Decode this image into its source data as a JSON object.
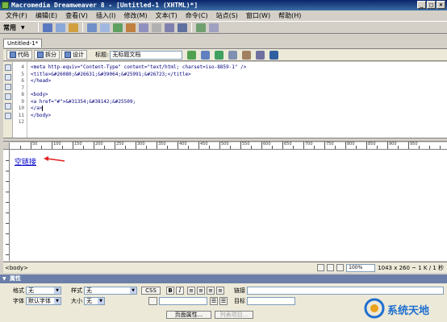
{
  "window": {
    "title": "Macromedia Dreamweaver 8 - [Untitled-1 (XHTML)*]",
    "controls": [
      "_",
      "□",
      "×"
    ]
  },
  "menu": [
    "文件(F)",
    "编辑(E)",
    "查看(V)",
    "插入(I)",
    "修改(M)",
    "文本(T)",
    "命令(C)",
    "站点(S)",
    "窗口(W)",
    "帮助(H)"
  ],
  "insert_bar": {
    "category": "常用"
  },
  "document": {
    "tab": "Untitled-1*",
    "views": {
      "code": "代码",
      "split": "拆分",
      "design": "设计"
    },
    "title_label": "标题:",
    "title_value": "无标题文档"
  },
  "code": {
    "line_numbers": [
      "4",
      "5",
      "6",
      "7",
      "8",
      "9",
      "10",
      "11",
      "12"
    ],
    "lines": [
      "<meta http-equiv=\"Content-Type\" content=\"text/html; charset=iso-8859-1\" />",
      "<title>&#26080;&#26631;&#39064;&#25991;&#26723;</title>",
      "</head>",
      "",
      "<body>",
      "<a href=\"#\">&#31354;&#38142;&#25509;",
      "</a>",
      "</body>",
      ""
    ]
  },
  "ruler": {
    "labels": [
      "50",
      "100",
      "150",
      "200",
      "250",
      "300",
      "350",
      "400",
      "450",
      "500",
      "550",
      "600",
      "650",
      "700",
      "750",
      "800",
      "850",
      "900",
      "950"
    ]
  },
  "design": {
    "link_text": "空链接",
    "arrow_color": "#e02020"
  },
  "status": {
    "tag_selector": "<body>",
    "zoom": "100%",
    "size": "1043 x 260 ~ 1 K / 1 秒"
  },
  "properties": {
    "header": "属性",
    "format_label": "格式",
    "format_value": "无",
    "style_label": "样式",
    "style_value": "无",
    "css_button": "CSS",
    "bold_button": "B",
    "italic_button": "I",
    "link_label": "链接",
    "font_label": "字体",
    "font_value": "默认字体",
    "size_label": "大小",
    "size_value": "无",
    "target_label": "目标",
    "page_props_button": "页面属性...",
    "list_item_button": "列表项目..."
  },
  "watermark": {
    "text": "系统天地",
    "color": "#1e6fd0"
  }
}
